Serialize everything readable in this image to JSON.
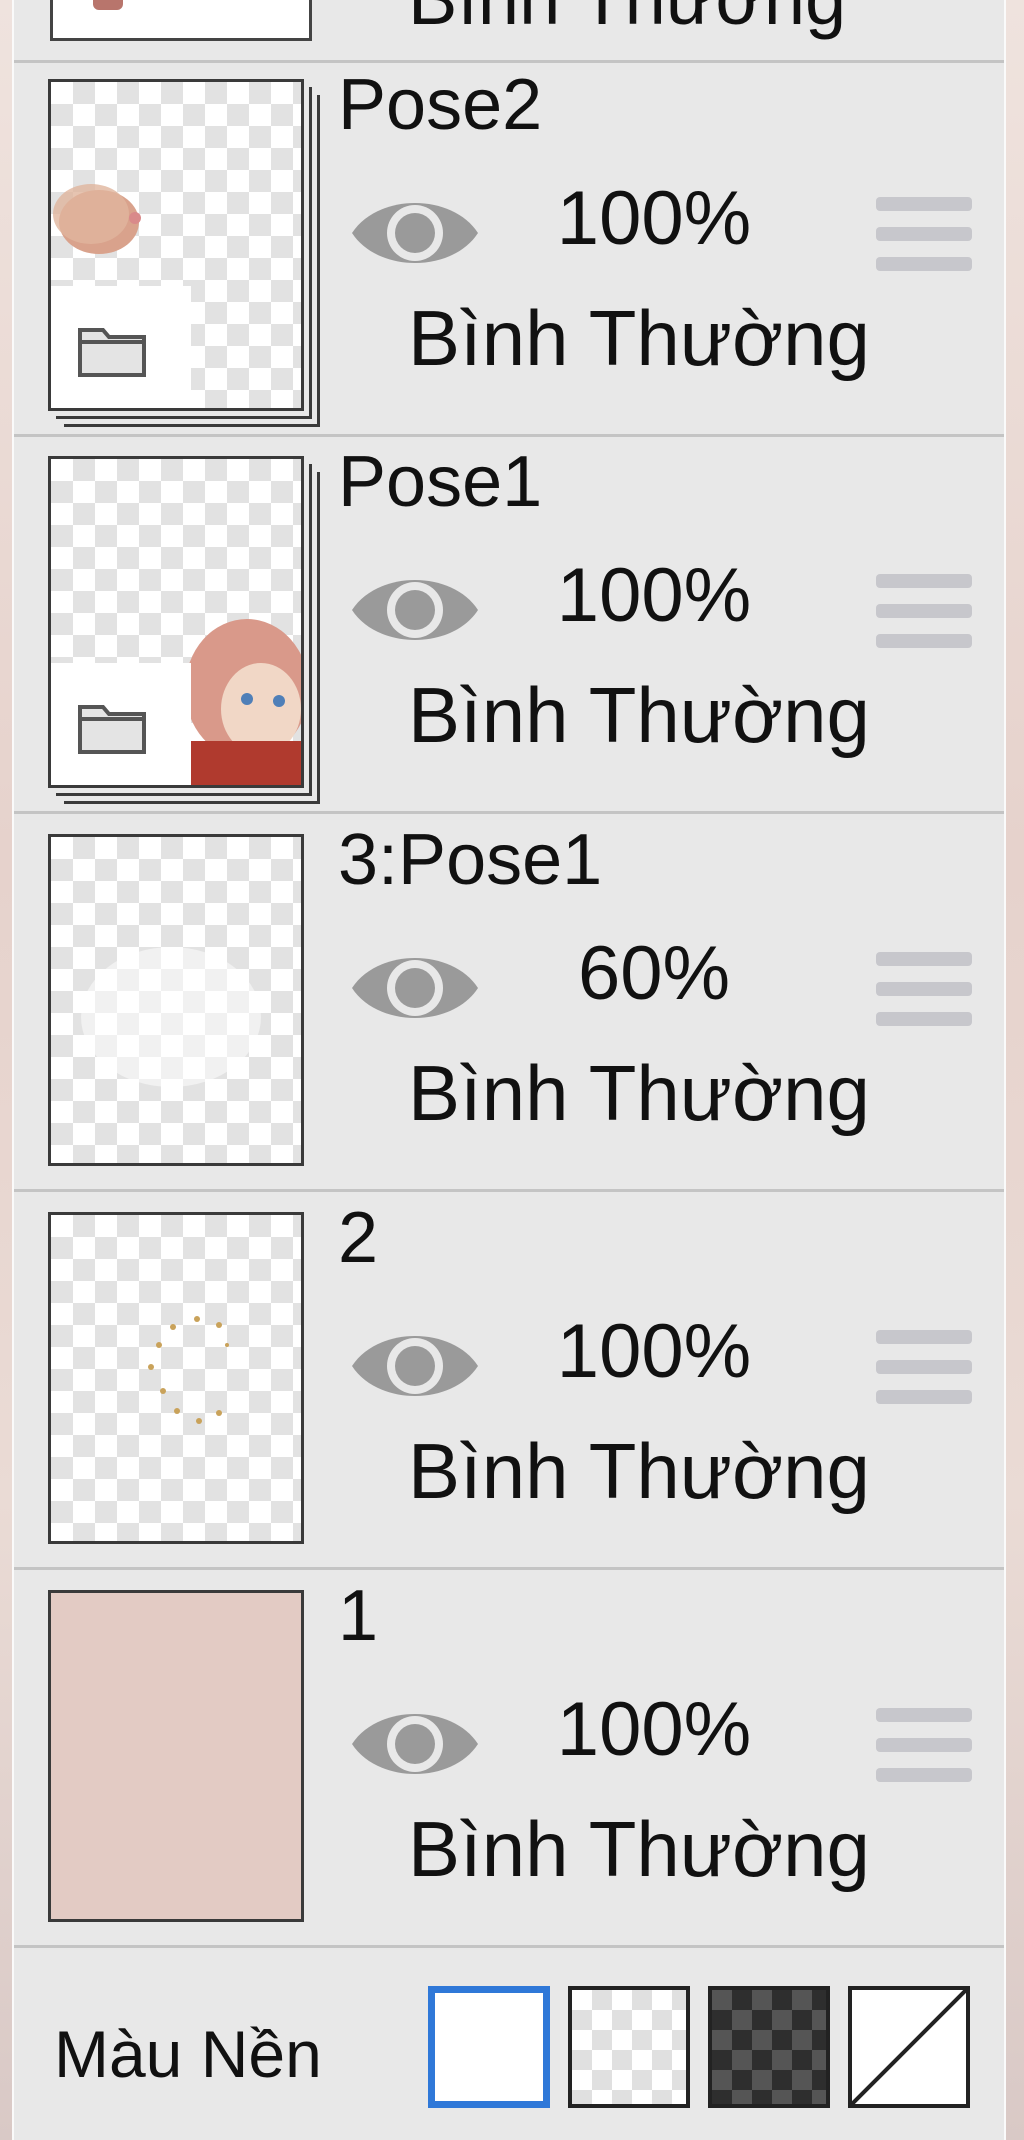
{
  "top_partial_layer": {
    "blend_mode": "Bình Thường"
  },
  "layers": [
    {
      "name": "Pose2",
      "opacity": "100%",
      "blend_mode": "Bình Thường",
      "type": "folder"
    },
    {
      "name": "Pose1",
      "opacity": "100%",
      "blend_mode": "Bình Thường",
      "type": "folder"
    },
    {
      "name": "3:Pose1",
      "opacity": "60%",
      "blend_mode": "Bình Thường",
      "type": "layer"
    },
    {
      "name": "2",
      "opacity": "100%",
      "blend_mode": "Bình Thường",
      "type": "layer"
    },
    {
      "name": "1",
      "opacity": "100%",
      "blend_mode": "Bình Thường",
      "type": "layer",
      "fill_color": "#e3cbc4"
    }
  ],
  "footer": {
    "label": "Màu Nền",
    "swatches": [
      "white",
      "light-checker",
      "dark-checker",
      "none"
    ],
    "selected_swatch": "white"
  },
  "colors": {
    "accent": "#2f78d8",
    "icon_gray": "#9a9a9a",
    "panel_bg": "#e8e8e8"
  },
  "icons": {
    "visibility": "eye-icon",
    "reorder": "drag-handle-icon",
    "folder": "folder-icon"
  }
}
